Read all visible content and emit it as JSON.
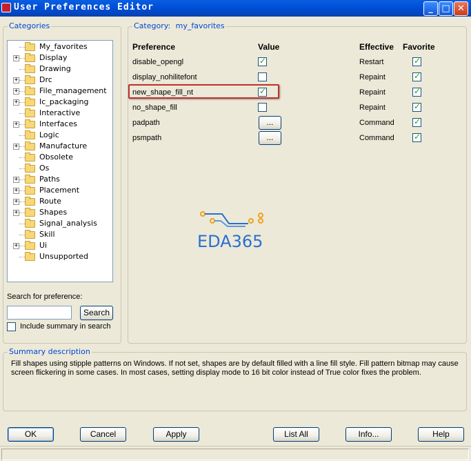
{
  "window": {
    "title": "User Preferences Editor",
    "controls": {
      "minimize": "_",
      "maximize": "□",
      "close": "✕"
    }
  },
  "categories": {
    "label": "Categories",
    "items": [
      {
        "label": "My_favorites",
        "expandable": false
      },
      {
        "label": "Display",
        "expandable": true
      },
      {
        "label": "Drawing",
        "expandable": false
      },
      {
        "label": "Drc",
        "expandable": true
      },
      {
        "label": "File_management",
        "expandable": true
      },
      {
        "label": "Ic_packaging",
        "expandable": true
      },
      {
        "label": "Interactive",
        "expandable": false
      },
      {
        "label": "Interfaces",
        "expandable": true
      },
      {
        "label": "Logic",
        "expandable": false
      },
      {
        "label": "Manufacture",
        "expandable": true
      },
      {
        "label": "Obsolete",
        "expandable": false
      },
      {
        "label": "Os",
        "expandable": false
      },
      {
        "label": "Paths",
        "expandable": true
      },
      {
        "label": "Placement",
        "expandable": true
      },
      {
        "label": "Route",
        "expandable": true
      },
      {
        "label": "Shapes",
        "expandable": true
      },
      {
        "label": "Signal_analysis",
        "expandable": false
      },
      {
        "label": "Skill",
        "expandable": false
      },
      {
        "label": "Ui",
        "expandable": true
      },
      {
        "label": "Unsupported",
        "expandable": false
      }
    ]
  },
  "search": {
    "label": "Search for preference:",
    "value": "",
    "button_label": "Search",
    "include_summary_label": "Include summary in search",
    "include_summary_checked": false
  },
  "category_panel": {
    "legend_prefix": "Category:",
    "category_name": "my_favorites",
    "columns": {
      "preference": "Preference",
      "value": "Value",
      "effective": "Effective",
      "favorite": "Favorite"
    },
    "rows": [
      {
        "name": "disable_opengl",
        "value_type": "checkbox",
        "value_checked": true,
        "effective": "Restart",
        "favorite": true
      },
      {
        "name": "display_nohilitefont",
        "value_type": "checkbox",
        "value_checked": false,
        "effective": "Repaint",
        "favorite": true
      },
      {
        "name": "new_shape_fill_nt",
        "value_type": "checkbox",
        "value_checked": true,
        "effective": "Repaint",
        "favorite": true
      },
      {
        "name": "no_shape_fill",
        "value_type": "checkbox",
        "value_checked": false,
        "effective": "Repaint",
        "favorite": true
      },
      {
        "name": "padpath",
        "value_type": "browse",
        "browse_label": "...",
        "effective": "Command",
        "favorite": true
      },
      {
        "name": "psmpath",
        "value_type": "browse",
        "browse_label": "...",
        "effective": "Command",
        "favorite": true
      }
    ],
    "highlighted_row": 2
  },
  "watermark": {
    "text": "EDA365"
  },
  "summary": {
    "label": "Summary description",
    "text": "Fill shapes using stipple patterns on Windows. If not set, shapes are by default filled with a line fill style. Fill pattern bitmap may cause screen flickering in some cases. In most cases, setting display mode to 16 bit color instead of True color fixes the problem."
  },
  "buttons": {
    "ok": "OK",
    "cancel": "Cancel",
    "apply": "Apply",
    "list_all": "List All",
    "info": "Info...",
    "help": "Help"
  },
  "colors": {
    "accent": "#0046d5",
    "highlight_border": "#c0302a",
    "check": "#21a121"
  }
}
